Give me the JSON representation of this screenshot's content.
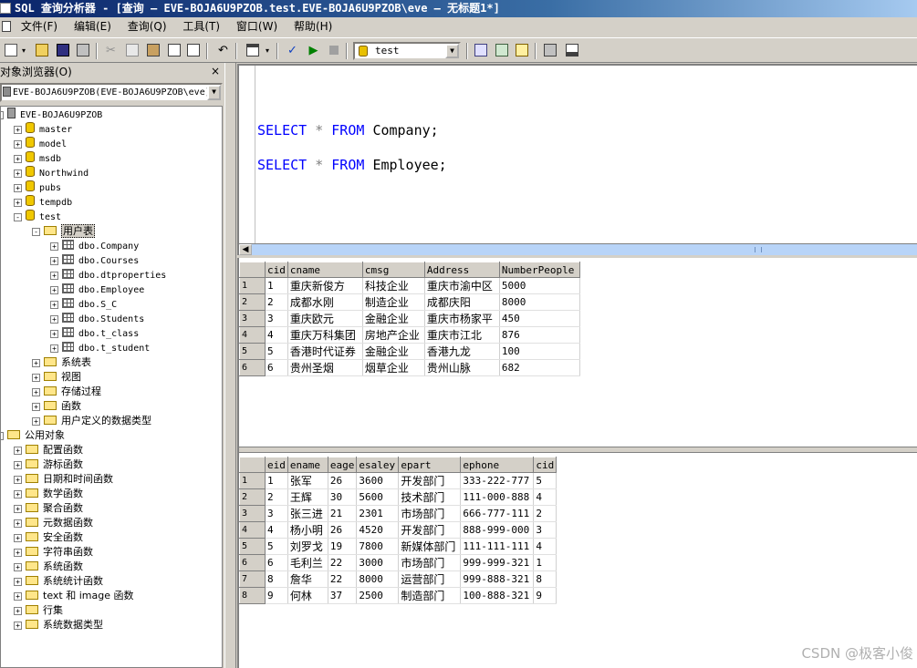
{
  "window": {
    "title": "SQL 查询分析器 - [查询 — EVE-BOJA6U9PZOB.test.EVE-BOJA6U9PZOB\\eve — 无标题1*]"
  },
  "menu": {
    "items": [
      "文件(F)",
      "编辑(E)",
      "查询(Q)",
      "工具(T)",
      "窗口(W)",
      "帮助(H)"
    ]
  },
  "toolbar": {
    "database": "test"
  },
  "object_browser": {
    "title": "对象浏览器(O)",
    "close": "×",
    "server_combo": "EVE-BOJA6U9PZOB(EVE-BOJA6U9PZOB\\eve)",
    "tree": [
      {
        "label": "EVE-BOJA6U9PZOB",
        "icon": "server-icon",
        "exp": "-"
      },
      {
        "label": "master",
        "icon": "database-icon",
        "exp": "+"
      },
      {
        "label": "model",
        "icon": "database-icon",
        "exp": "+"
      },
      {
        "label": "msdb",
        "icon": "database-icon",
        "exp": "+"
      },
      {
        "label": "Northwind",
        "icon": "database-icon",
        "exp": "+"
      },
      {
        "label": "pubs",
        "icon": "database-icon",
        "exp": "+"
      },
      {
        "label": "tempdb",
        "icon": "database-icon",
        "exp": "+"
      },
      {
        "label": "test",
        "icon": "database-icon",
        "exp": "-"
      },
      {
        "label": "用户表",
        "icon": "folder-icon",
        "exp": "-"
      },
      {
        "label": "dbo.Company",
        "icon": "table-icon",
        "exp": "+"
      },
      {
        "label": "dbo.Courses",
        "icon": "table-icon",
        "exp": "+"
      },
      {
        "label": "dbo.dtproperties",
        "icon": "table-icon",
        "exp": "+"
      },
      {
        "label": "dbo.Employee",
        "icon": "table-icon",
        "exp": "+"
      },
      {
        "label": "dbo.S_C",
        "icon": "table-icon",
        "exp": "+"
      },
      {
        "label": "dbo.Students",
        "icon": "table-icon",
        "exp": "+"
      },
      {
        "label": "dbo.t_class",
        "icon": "table-icon",
        "exp": "+"
      },
      {
        "label": "dbo.t_student",
        "icon": "table-icon",
        "exp": "+"
      },
      {
        "label": "系统表",
        "icon": "folder-icon",
        "exp": "+"
      },
      {
        "label": "视图",
        "icon": "folder-icon",
        "exp": "+"
      },
      {
        "label": "存储过程",
        "icon": "folder-icon",
        "exp": "+"
      },
      {
        "label": "函数",
        "icon": "folder-icon",
        "exp": "+"
      },
      {
        "label": "用户定义的数据类型",
        "icon": "folder-icon",
        "exp": "+"
      },
      {
        "label": "公用对象",
        "icon": "folder-icon",
        "exp": "-"
      },
      {
        "label": "配置函数",
        "icon": "folder-icon",
        "exp": "+"
      },
      {
        "label": "游标函数",
        "icon": "folder-icon",
        "exp": "+"
      },
      {
        "label": "日期和时间函数",
        "icon": "folder-icon",
        "exp": "+"
      },
      {
        "label": "数学函数",
        "icon": "folder-icon",
        "exp": "+"
      },
      {
        "label": "聚合函数",
        "icon": "folder-icon",
        "exp": "+"
      },
      {
        "label": "元数据函数",
        "icon": "folder-icon",
        "exp": "+"
      },
      {
        "label": "安全函数",
        "icon": "folder-icon",
        "exp": "+"
      },
      {
        "label": "字符串函数",
        "icon": "folder-icon",
        "exp": "+"
      },
      {
        "label": "系统函数",
        "icon": "folder-icon",
        "exp": "+"
      },
      {
        "label": "系统统计函数",
        "icon": "folder-icon",
        "exp": "+"
      },
      {
        "label": "text 和 image 函数",
        "icon": "folder-icon",
        "exp": "+"
      },
      {
        "label": "行集",
        "icon": "folder-icon",
        "exp": "+"
      },
      {
        "label": "系统数据类型",
        "icon": "folder-icon",
        "exp": "+"
      }
    ]
  },
  "editor": {
    "lines": [
      {
        "kw1": "SELECT",
        "op": "*",
        "kw2": "FROM",
        "table": "Company;"
      },
      {
        "kw1": "SELECT",
        "op": "*",
        "kw2": "FROM",
        "table": "Employee;"
      }
    ]
  },
  "results": {
    "company": {
      "columns": [
        "cid",
        "cname",
        "cmsg",
        "Address",
        "NumberPeople"
      ],
      "rows": [
        [
          "1",
          "重庆新俊方",
          "科技企业",
          "重庆市渝中区",
          "5000"
        ],
        [
          "2",
          "成都水刚",
          "制造企业",
          "成都庆阳",
          "8000"
        ],
        [
          "3",
          "重庆欧元",
          "金融企业",
          "重庆市杨家平",
          "450"
        ],
        [
          "4",
          "重庆万科集团",
          "房地产企业",
          "重庆市江北",
          "876"
        ],
        [
          "5",
          "香港时代证券",
          "金融企业",
          "香港九龙",
          "100"
        ],
        [
          "6",
          "贵州圣烟",
          "烟草企业",
          "贵州山脉",
          "682"
        ]
      ]
    },
    "employee": {
      "columns": [
        "eid",
        "ename",
        "eage",
        "esaley",
        "epart",
        "ephone",
        "cid"
      ],
      "rows": [
        [
          "1",
          "张军",
          "26",
          "3600",
          "开发部门",
          "333-222-777",
          "5"
        ],
        [
          "2",
          "王辉",
          "30",
          "5600",
          "技术部门",
          "111-000-888",
          "4"
        ],
        [
          "3",
          "张三进",
          "21",
          "2301",
          "市场部门",
          "666-777-111",
          "2"
        ],
        [
          "4",
          "杨小明",
          "26",
          "4520",
          "开发部门",
          "888-999-000",
          "3"
        ],
        [
          "5",
          "刘罗戈",
          "19",
          "7800",
          "新媒体部门",
          "111-111-111",
          "4"
        ],
        [
          "6",
          "毛利兰",
          "22",
          "3000",
          "市场部门",
          "999-999-321",
          "1"
        ],
        [
          "8",
          "詹华",
          "22",
          "8000",
          "运营部门",
          "999-888-321",
          "8"
        ],
        [
          "9",
          "何林",
          "37",
          "2500",
          "制造部门",
          "100-888-321",
          "9"
        ]
      ]
    }
  },
  "watermark": "CSDN @极客小俊"
}
